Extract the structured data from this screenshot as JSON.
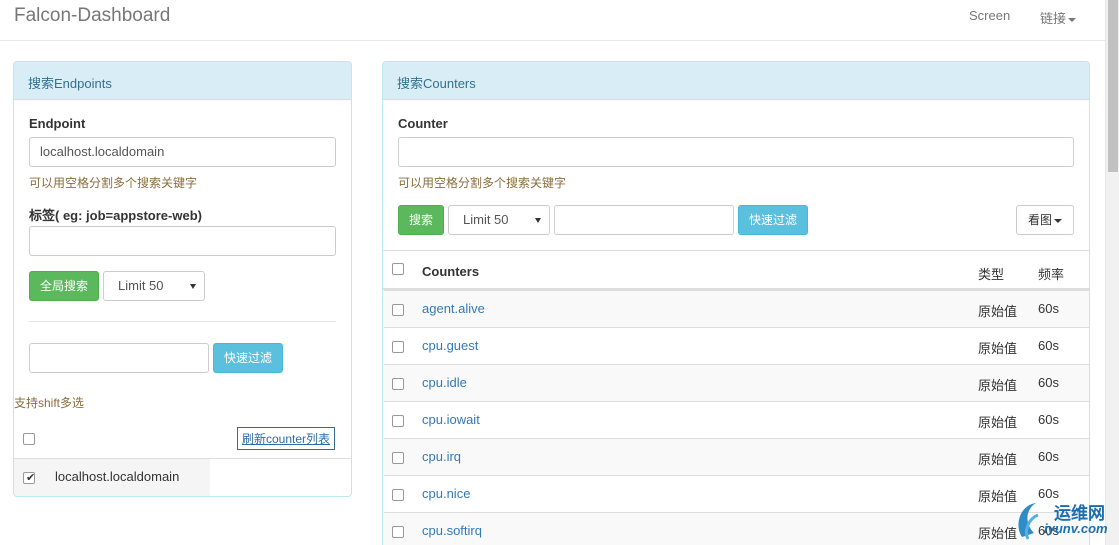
{
  "navbar": {
    "brand": "Falcon-Dashboard",
    "screen_label": "Screen",
    "links_label": "链接"
  },
  "endpoints_panel": {
    "heading": "搜索Endpoints",
    "endpoint_label": "Endpoint",
    "endpoint_value": "localhost.localdomain",
    "endpoint_help": "可以用空格分割多个搜索关键字",
    "tag_label": "标签( eg: job=appstore-web)",
    "tag_value": "",
    "search_button": "全局搜索",
    "limit_selected": "Limit 50",
    "filter_value": "",
    "filter_button": "快速过滤",
    "shift_help": "支持shift多选",
    "refresh_button": "刷新counter列表",
    "endpoints": [
      {
        "name": "localhost.localdomain",
        "checked": true
      }
    ]
  },
  "counters_panel": {
    "heading": "搜索Counters",
    "counter_label": "Counter",
    "counter_value": "",
    "counter_help": "可以用空格分割多个搜索关键字",
    "search_button": "搜索",
    "limit_selected": "Limit 50",
    "filter_value": "",
    "filter_button": "快速过滤",
    "view_button": "看图",
    "columns": {
      "counters": "Counters",
      "type": "类型",
      "freq": "频率"
    },
    "rows": [
      {
        "name": "agent.alive",
        "type": "原始值",
        "freq": "60s"
      },
      {
        "name": "cpu.guest",
        "type": "原始值",
        "freq": "60s"
      },
      {
        "name": "cpu.idle",
        "type": "原始值",
        "freq": "60s"
      },
      {
        "name": "cpu.iowait",
        "type": "原始值",
        "freq": "60s"
      },
      {
        "name": "cpu.irq",
        "type": "原始值",
        "freq": "60s"
      },
      {
        "name": "cpu.nice",
        "type": "原始值",
        "freq": "60s"
      },
      {
        "name": "cpu.softirq",
        "type": "原始值",
        "freq": "60s"
      }
    ]
  },
  "watermark": {
    "text_cn": "运维网",
    "text_en": "iyunv.com"
  }
}
